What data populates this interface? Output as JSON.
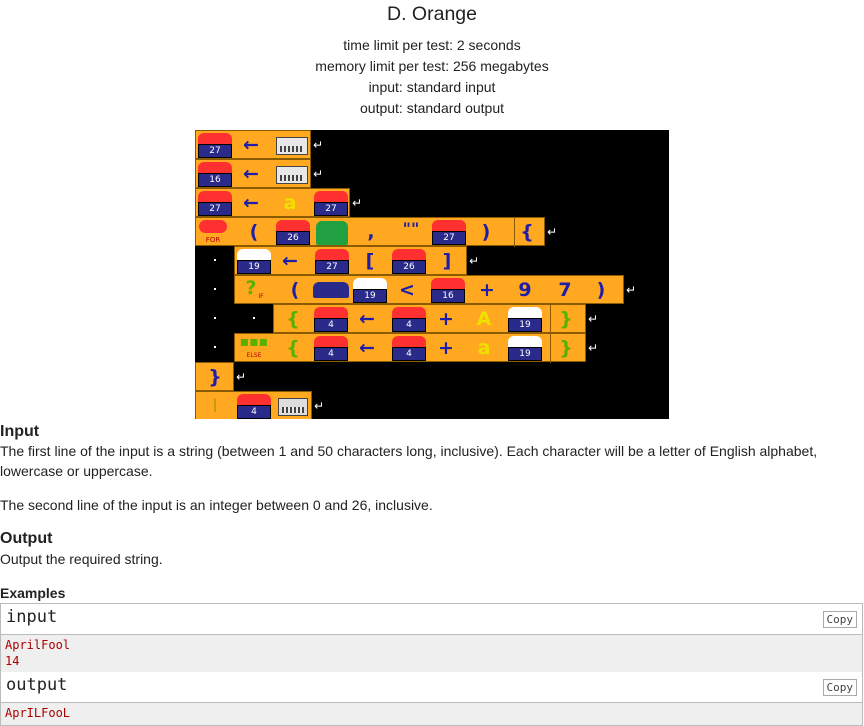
{
  "header": {
    "title": "D. Orange",
    "time_limit": "time limit per test: 2 seconds",
    "memory_limit": "memory limit per test: 256 megabytes",
    "input": "input: standard input",
    "output": "output: standard output"
  },
  "program_image": {
    "tokens": {
      "arrow": "←",
      "a": "a",
      "A": "A",
      "lparen": "(",
      "rparen": ")",
      "lbrace": "{",
      "rbrace": "}",
      "lbracket": "[",
      "rbracket": "]",
      "comma": ",",
      "lt": "<",
      "plus": "+",
      "nine": "9",
      "seven": "7",
      "quotes": "\"\"",
      "question": "?",
      "ret": "↵",
      "n27": "27",
      "n16": "16",
      "n26": "26",
      "n19": "19",
      "n4": "4",
      "for": "FOR",
      "if": "IF",
      "else": "ELSE",
      "cursor": "I"
    }
  },
  "sections": {
    "input_title": "Input",
    "input_p1": "The first line of the input is a string (between 1 and 50 characters long, inclusive). Each character will be a letter of English alphabet, lowercase or uppercase.",
    "input_p2": "The second line of the input is an integer between 0 and 26, inclusive.",
    "output_title": "Output",
    "output_p1": "Output the required string.",
    "examples_title": "Examples"
  },
  "examples": {
    "input_label": "input",
    "output_label": "output",
    "copy_label": "Copy",
    "input_line1": "AprilFool",
    "input_line2": "14",
    "output_line1": "AprILFooL"
  }
}
